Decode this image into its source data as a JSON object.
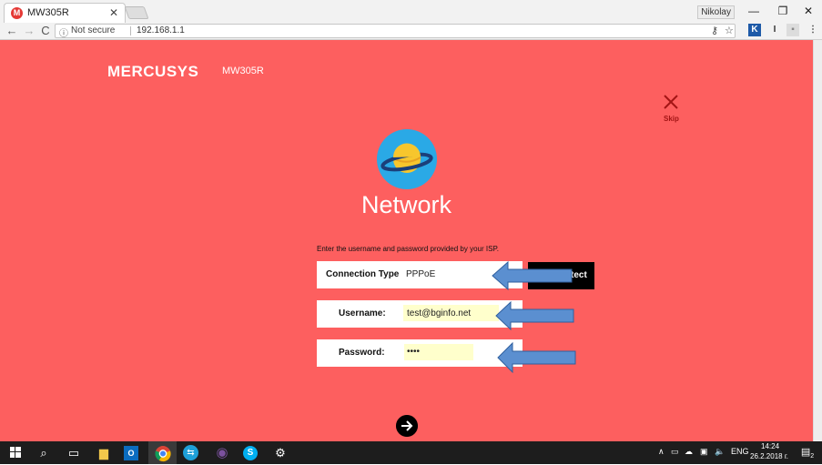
{
  "browser": {
    "tab_title": "MW305R",
    "tab_favicon_letter": "M",
    "profile_name": "Nikolay",
    "url_security": "Not secure",
    "url": "192.168.1.1"
  },
  "header": {
    "logo": "MERCUSYS",
    "model": "MW305R",
    "skip_label": "Skip"
  },
  "main": {
    "title": "Network",
    "instruction": "Enter the username and password provided by your ISP.",
    "connection_type_label": "Connection Type",
    "connection_type_value": "PPPoE",
    "detect_label": "tect",
    "username_label": "Username:",
    "username_value": "test@bginfo.net",
    "password_label": "Password:",
    "password_value": "••••"
  },
  "colors": {
    "page_bg": "#fd5f5f",
    "arrow_fill": "#5b8fd0",
    "arrow_stroke": "#2f5f9e",
    "input_highlight": "#ffffcc"
  },
  "taskbar": {
    "language": "ENG",
    "time": "14:24",
    "date": "26.2.2018 г.",
    "notification_count": "2"
  }
}
